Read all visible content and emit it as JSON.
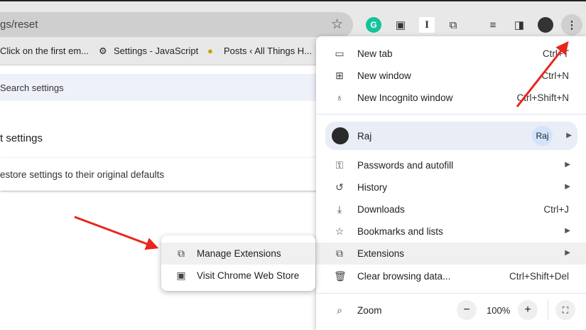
{
  "toolbar": {
    "url": "gs/reset",
    "icons": [
      "bookmark-star-icon",
      "grammarly-icon",
      "picture-in-picture-icon",
      "instapaper-icon",
      "extensions-icon",
      "reading-list-icon",
      "side-panel-icon",
      "profile-avatar",
      "more-menu-icon"
    ]
  },
  "bookmarks": [
    "Click on the first em...",
    "Settings - JavaScript",
    "Posts ‹ All Things H..."
  ],
  "page": {
    "search_placeholder": "Search settings",
    "section_title": "t settings",
    "restore_label": "estore settings to their original defaults"
  },
  "menu": {
    "new_tab": {
      "label": "New tab",
      "shortcut": "Ctrl+T"
    },
    "new_window": {
      "label": "New window",
      "shortcut": "Ctrl+N"
    },
    "incognito": {
      "label": "New Incognito window",
      "shortcut": "Ctrl+Shift+N"
    },
    "profile": {
      "name": "Raj",
      "badge": "Raj"
    },
    "passwords": {
      "label": "Passwords and autofill"
    },
    "history": {
      "label": "History"
    },
    "downloads": {
      "label": "Downloads",
      "shortcut": "Ctrl+J"
    },
    "bookmarks": {
      "label": "Bookmarks and lists"
    },
    "extensions": {
      "label": "Extensions"
    },
    "clear": {
      "label": "Clear browsing data...",
      "shortcut": "Ctrl+Shift+Del"
    },
    "zoom": {
      "label": "Zoom",
      "value": "100%",
      "minus": "−",
      "plus": "+"
    }
  },
  "submenu": {
    "manage": "Manage Extensions",
    "store": "Visit Chrome Web Store"
  },
  "colors": {
    "arrow": "#e8261b",
    "hover": "#f0f0f0",
    "profile_bg": "#e9edf6"
  }
}
